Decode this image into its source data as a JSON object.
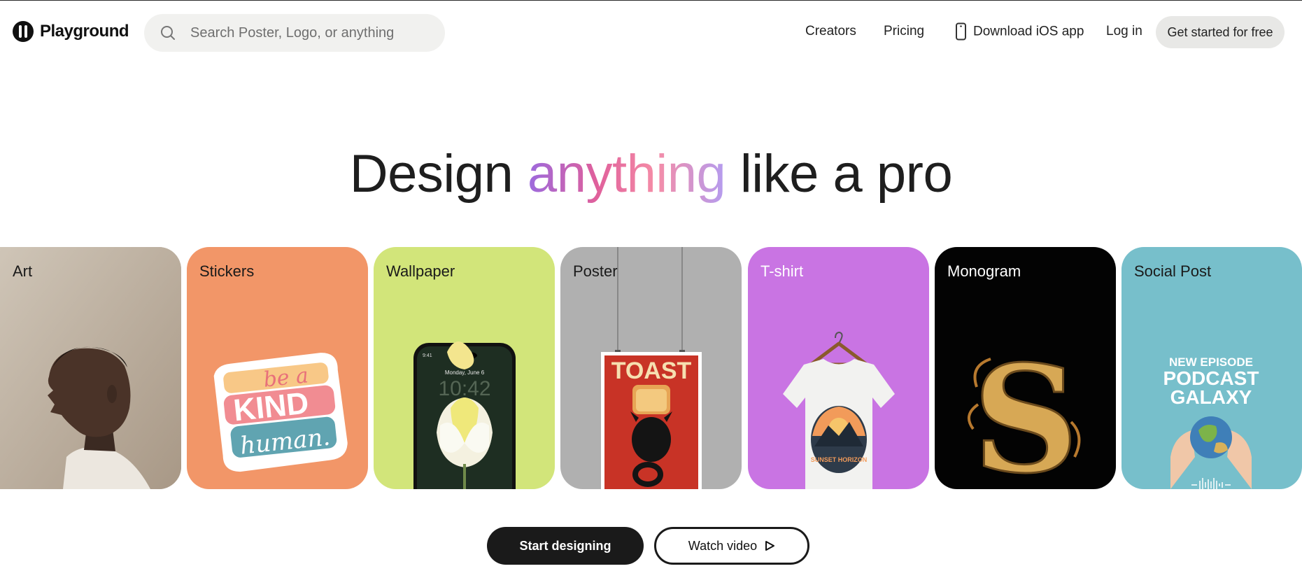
{
  "header": {
    "brand": "Playground",
    "search_placeholder": "Search Poster, Logo, or anything",
    "nav": {
      "creators": "Creators",
      "pricing": "Pricing",
      "download_ios": "Download iOS app",
      "login": "Log in",
      "get_started": "Get started for free"
    }
  },
  "hero": {
    "title_before": "Design ",
    "title_highlight": "anything",
    "title_after": " like a pro"
  },
  "cards": [
    {
      "label": "Art",
      "color": "#c3b7a8"
    },
    {
      "label": "Stickers",
      "color": "#f29668",
      "sticker_lines": [
        "be a",
        "KIND",
        "human."
      ]
    },
    {
      "label": "Wallpaper",
      "color": "#d2e57a",
      "phone_date": "Monday, June 6",
      "phone_time": "10:42",
      "phone_status": "9:41"
    },
    {
      "label": "Poster",
      "color": "#b0b0b0",
      "poster_title": "TOAST"
    },
    {
      "label": "T-shirt",
      "color": "#c974e3",
      "shirt_text": "SUNSET HORIZON"
    },
    {
      "label": "Monogram",
      "color": "#030303",
      "letter": "S"
    },
    {
      "label": "Social Post",
      "color": "#77bfcb",
      "post_lines": [
        "NEW EPISODE",
        "PODCAST",
        "GALAXY"
      ]
    }
  ],
  "cta": {
    "start": "Start designing",
    "watch": "Watch video"
  },
  "icons": {
    "search": "search-icon",
    "phone": "phone-icon",
    "play": "play-icon",
    "logo": "logo-icon"
  }
}
